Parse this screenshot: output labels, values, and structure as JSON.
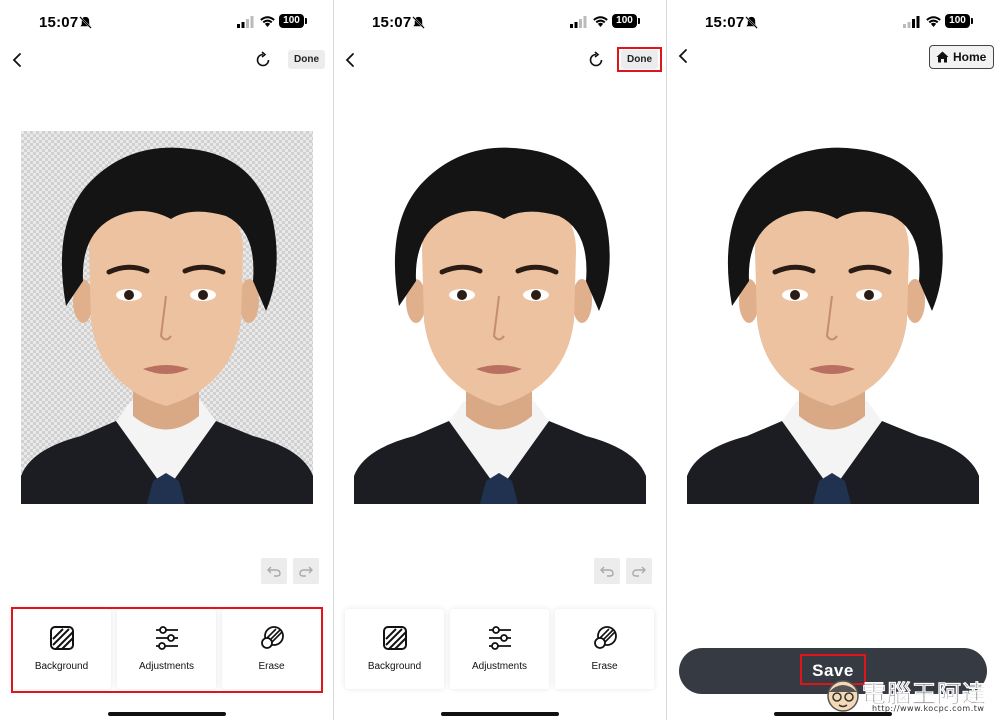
{
  "status_bar": {
    "time": "15:07",
    "battery": "100"
  },
  "panels": [
    {
      "id": "transparent-edit",
      "done_label": "Done",
      "tools": [
        {
          "label": "Background",
          "icon": "background-icon"
        },
        {
          "label": "Adjustments",
          "icon": "sliders-icon"
        },
        {
          "label": "Erase",
          "icon": "eraser-icon"
        }
      ]
    },
    {
      "id": "white-background",
      "done_label": "Done",
      "tools": [
        {
          "label": "Background",
          "icon": "background-icon"
        },
        {
          "label": "Adjustments",
          "icon": "sliders-icon"
        },
        {
          "label": "Erase",
          "icon": "eraser-icon"
        }
      ]
    },
    {
      "id": "final",
      "home_label": "Home",
      "save_label": "Save"
    }
  ],
  "watermark": {
    "text": "電腦王阿達",
    "url": "http://www.kocpc.com.tw"
  },
  "colors": {
    "highlight": "#e0141b",
    "save_button": "#353a43",
    "done_bg": "#ececec"
  }
}
